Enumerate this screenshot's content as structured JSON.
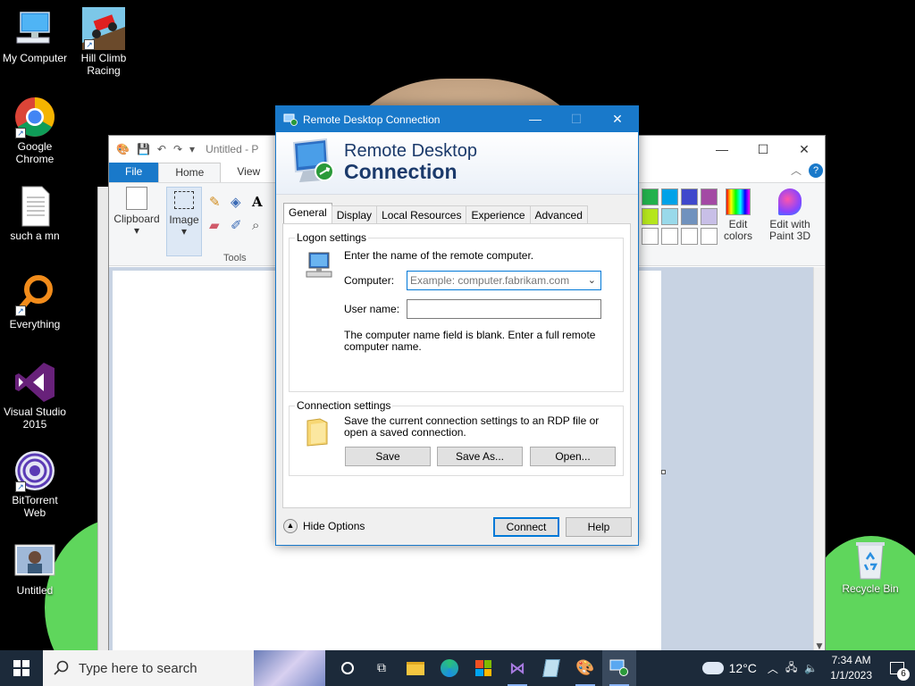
{
  "desktop": {
    "icons": [
      {
        "label": "My Computer"
      },
      {
        "label": "Hill Climb Racing"
      },
      {
        "label": "Google Chrome"
      },
      {
        "label": "such a mn"
      },
      {
        "label": "Everything"
      },
      {
        "label": "Visual Studio 2015"
      },
      {
        "label": "BitTorrent Web"
      },
      {
        "label": "Untitled"
      },
      {
        "label": "Recycle Bin"
      }
    ]
  },
  "paint": {
    "title": "Untitled - P",
    "tabs": [
      "File",
      "Home",
      "View"
    ],
    "ribbon": {
      "clipboard_label": "Clipboard",
      "image_label": "Image",
      "tools_label": "Tools",
      "edit_colors_label": "Edit colors",
      "paint3d_label": "Edit with Paint 3D"
    },
    "palette": [
      "#22b14c",
      "#00a2e8",
      "#3f48cc",
      "#a349a4",
      "#b5e61d",
      "#99d9ea",
      "#7092be",
      "#c8bfe7",
      "#ffffff",
      "#ffffff",
      "#ffffff",
      "#ffffff"
    ]
  },
  "rdc": {
    "window_title": "Remote Desktop Connection",
    "banner_line1": "Remote Desktop",
    "banner_line2": "Connection",
    "tabs": [
      "General",
      "Display",
      "Local Resources",
      "Experience",
      "Advanced"
    ],
    "logon": {
      "legend": "Logon settings",
      "intro": "Enter the name of the remote computer.",
      "computer_label": "Computer:",
      "computer_placeholder": "Example: computer.fabrikam.com",
      "username_label": "User name:",
      "username_value": "",
      "hint": "The computer name field is blank. Enter a full remote computer name."
    },
    "connection": {
      "legend": "Connection settings",
      "text": "Save the current connection settings to an RDP file or open a saved connection.",
      "save": "Save",
      "save_as": "Save As...",
      "open": "Open..."
    },
    "hide_options": "Hide Options",
    "connect": "Connect",
    "help": "Help"
  },
  "taskbar": {
    "search_placeholder": "Type here to search",
    "weather": "12°C",
    "time": "7:34 AM",
    "date": "1/1/2023",
    "notification_count": "6"
  },
  "colors": {
    "accent": "#1979ca",
    "taskbar": "#1c2a3a"
  }
}
